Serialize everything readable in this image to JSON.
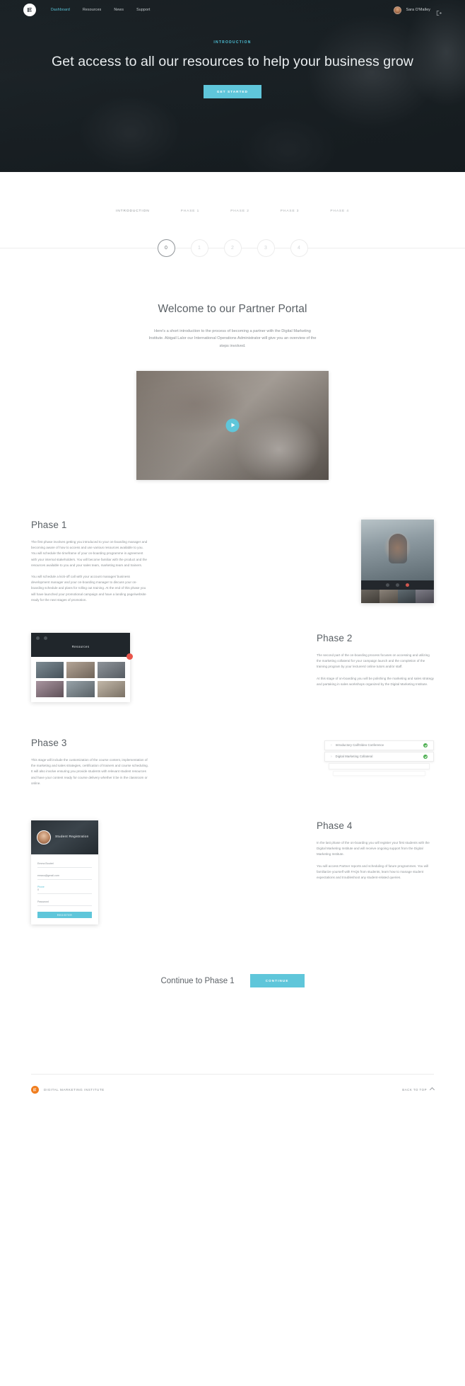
{
  "nav": {
    "brand_icon": "dmi-logo-icon",
    "links": [
      {
        "label": "Dashboard",
        "active": true
      },
      {
        "label": "Resources",
        "active": false
      },
      {
        "label": "News",
        "active": false
      },
      {
        "label": "Support",
        "active": false
      }
    ],
    "user_name": "Sara O'Malley",
    "logout_icon": "logout-icon"
  },
  "hero": {
    "eyebrow": "INTRODUCTION",
    "title": "Get access to all our resources to help your business grow",
    "cta": "GET STARTED"
  },
  "stepper": {
    "tabs": [
      {
        "label": "INTRODUCTION",
        "active": true
      },
      {
        "label": "PHASE 1",
        "active": false
      },
      {
        "label": "PHASE 2",
        "active": false
      },
      {
        "label": "PHASE 3",
        "active": false
      },
      {
        "label": "PHASE 4",
        "active": false
      }
    ],
    "steps": [
      {
        "number": "0",
        "active": true
      },
      {
        "number": "1",
        "active": false
      },
      {
        "number": "2",
        "active": false
      },
      {
        "number": "3",
        "active": false
      },
      {
        "number": "4",
        "active": false
      }
    ]
  },
  "welcome": {
    "title": "Welcome to our Partner Portal",
    "body": "Here's a short introduction to the process of becoming a partner with the Digital Marketing Institute.  Abigail Lalor our International Operations Administrator will give you an overview of the steps involved.",
    "play_icon": "play-icon"
  },
  "phases": [
    {
      "title": "Phase 1",
      "p1": "The first phase involves getting you introduced to your on-boarding manager and becoming aware of how to access and use various resources available to you. You will schedule the timeframe of your on-boarding programme in agreement with your internal stakeholders. You will become familiar with the product and the resources available to you and your sales team, marketing team and trainers.",
      "p2": "You will schedule a kick-off call with your account manager/ business development manager and your on-boarding manager to discuss your on-boarding schedule and plans for rolling out training. At the end of this phase you will have launched your promotional campaign and have a landing page/website ready for the next stages of promotion."
    },
    {
      "title": "Phase 2",
      "p1": "The second part of the on-boarding process focuses on accessing and utilizing the marketing collateral for your campaign launch and the completion of the training program by your lecturers/ online tutors and/or staff.",
      "p2": "At this stage of on-boarding you will be polishing the marketing and sales strategy and partaking in sales workshops organized by the Digital Marketing Institute."
    },
    {
      "title": "Phase 3",
      "p1": "This stage will include the customization of the course content, implementation of the marketing and sales strategies, certification of trainers and course scheduling. It will also involve ensuring you provide students with relevant student resources and have your content ready for course delivery whether it be in the classroom or online."
    },
    {
      "title": "Phase 4",
      "p1": "In the last phase of the on-boarding you will register your first students with the Digital Marketing Institute and will receive ongoing support from the Digital Marketing Institute.",
      "p2": "You will access Partner reports and scheduling of future programmes. You will familiarize yourself with FAQs from students, learn how to manage student expectations and troubleshoot any student-related queries."
    }
  ],
  "media": {
    "browser_title": "Resources",
    "checklist": [
      {
        "label": "Introductory Call/Video Conference",
        "status": "complete"
      },
      {
        "label": "Digital Marketing Collateral",
        "status": "complete"
      }
    ],
    "form": {
      "heading": "Student Registration",
      "name_value": "Emma Boutrel",
      "email_value": "emaxo@gmail.com",
      "phone_label": "Phone",
      "phone_value": "0",
      "password_value": "Password",
      "submit_label": "Register"
    }
  },
  "continue": {
    "text": "Continue to Phase 1",
    "button": "CONTINUE"
  },
  "footer": {
    "brand": "DIGITAL MARKETING INSTITUTE",
    "back_to_top": "BACK TO TOP",
    "caret_icon": "caret-up-icon"
  },
  "colors": {
    "accent": "#5fc6da",
    "hero_bg": "#1d2529",
    "footer_logo": "#f07d1e",
    "status_complete": "#4caf50"
  }
}
